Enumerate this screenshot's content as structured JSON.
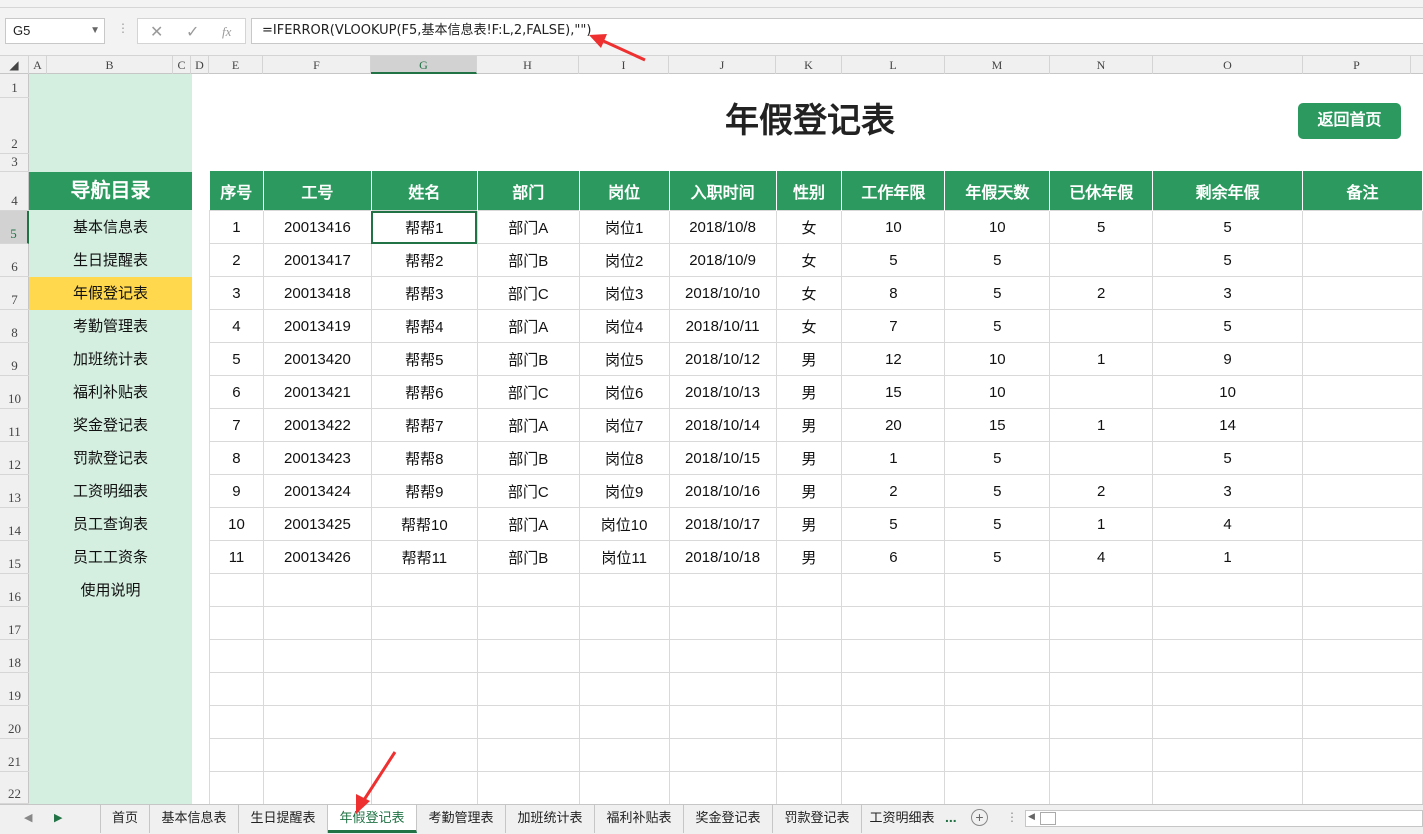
{
  "formula_bar": {
    "name_box": "G5",
    "cancel_symbol": "✕",
    "enter_symbol": "✓",
    "fx_symbol": "fx",
    "formula": "=IFERROR(VLOOKUP(F5,基本信息表!F:L,2,FALSE),\"\")"
  },
  "columns": [
    "A",
    "B",
    "C",
    "D",
    "E",
    "F",
    "G",
    "H",
    "I",
    "J",
    "K",
    "L",
    "M",
    "N",
    "O",
    "P"
  ],
  "rows": [
    "1",
    "2",
    "3",
    "4",
    "5",
    "6",
    "7",
    "8",
    "9",
    "10",
    "11",
    "12",
    "13",
    "14",
    "15",
    "16",
    "17",
    "18",
    "19",
    "20",
    "21",
    "22"
  ],
  "nav": {
    "title": "导航目录",
    "items": [
      "基本信息表",
      "生日提醒表",
      "年假登记表",
      "考勤管理表",
      "加班统计表",
      "福利补贴表",
      "奖金登记表",
      "罚款登记表",
      "工资明细表",
      "员工查询表",
      "员工工资条",
      "使用说明"
    ],
    "active_index": 2
  },
  "title": "年假登记表",
  "back_button": "返回首页",
  "table": {
    "headers": [
      "序号",
      "工号",
      "姓名",
      "部门",
      "岗位",
      "入职时间",
      "性别",
      "工作年限",
      "年假天数",
      "已休年假",
      "剩余年假",
      "备注"
    ],
    "rows": [
      [
        "1",
        "20013416",
        "帮帮1",
        "部门A",
        "岗位1",
        "2018/10/8",
        "女",
        "10",
        "10",
        "5",
        "5",
        ""
      ],
      [
        "2",
        "20013417",
        "帮帮2",
        "部门B",
        "岗位2",
        "2018/10/9",
        "女",
        "5",
        "5",
        "",
        "5",
        ""
      ],
      [
        "3",
        "20013418",
        "帮帮3",
        "部门C",
        "岗位3",
        "2018/10/10",
        "女",
        "8",
        "5",
        "2",
        "3",
        ""
      ],
      [
        "4",
        "20013419",
        "帮帮4",
        "部门A",
        "岗位4",
        "2018/10/11",
        "女",
        "7",
        "5",
        "",
        "5",
        ""
      ],
      [
        "5",
        "20013420",
        "帮帮5",
        "部门B",
        "岗位5",
        "2018/10/12",
        "男",
        "12",
        "10",
        "1",
        "9",
        ""
      ],
      [
        "6",
        "20013421",
        "帮帮6",
        "部门C",
        "岗位6",
        "2018/10/13",
        "男",
        "15",
        "10",
        "",
        "10",
        ""
      ],
      [
        "7",
        "20013422",
        "帮帮7",
        "部门A",
        "岗位7",
        "2018/10/14",
        "男",
        "20",
        "15",
        "1",
        "14",
        ""
      ],
      [
        "8",
        "20013423",
        "帮帮8",
        "部门B",
        "岗位8",
        "2018/10/15",
        "男",
        "1",
        "5",
        "",
        "5",
        ""
      ],
      [
        "9",
        "20013424",
        "帮帮9",
        "部门C",
        "岗位9",
        "2018/10/16",
        "男",
        "2",
        "5",
        "2",
        "3",
        ""
      ],
      [
        "10",
        "20013425",
        "帮帮10",
        "部门A",
        "岗位10",
        "2018/10/17",
        "男",
        "5",
        "5",
        "1",
        "4",
        ""
      ],
      [
        "11",
        "20013426",
        "帮帮11",
        "部门B",
        "岗位11",
        "2018/10/18",
        "男",
        "6",
        "5",
        "4",
        "1",
        ""
      ]
    ],
    "empty_rows": 7
  },
  "sheet_tabs": {
    "tabs": [
      "首页",
      "基本信息表",
      "生日提醒表",
      "年假登记表",
      "考勤管理表",
      "加班统计表",
      "福利补贴表",
      "奖金登记表",
      "罚款登记表",
      "工资明细表"
    ],
    "active_index": 3,
    "more": "...",
    "add": "+"
  },
  "colors": {
    "accent_green": "#2c9a5f",
    "nav_bg": "#d4eee0",
    "nav_active": "#ffd84d",
    "excel_green": "#217346",
    "annotation_red": "#ee3030"
  }
}
